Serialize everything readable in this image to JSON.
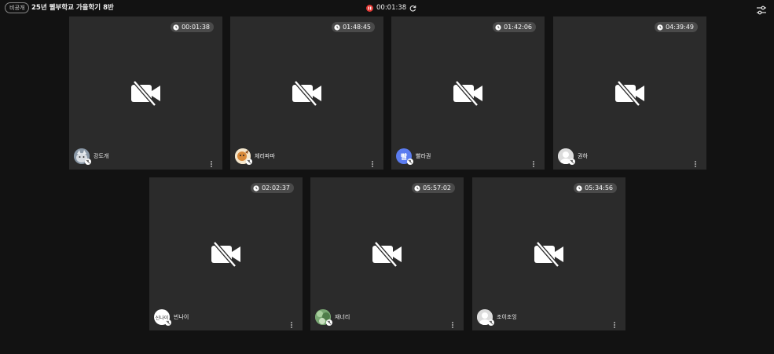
{
  "header": {
    "visibility_badge": "비공개",
    "room_title": "25년 웰부학교 가을학기 8반",
    "recording_time": "00:01:38",
    "recording_color": "#e53935"
  },
  "tiles": [
    {
      "name": "강도개",
      "timer": "00:01:38",
      "avatar": "photo-husky"
    },
    {
      "name": "체리파파",
      "timer": "01:48:45",
      "avatar": "photo-cartoon"
    },
    {
      "name": "빨라권",
      "timer": "01:42:06",
      "avatar": "initial",
      "initial": "빨",
      "avatar_color": "#5b7cf0"
    },
    {
      "name": "권하",
      "timer": "04:39:49",
      "avatar": "default-person"
    },
    {
      "name": "빈나이",
      "timer": "02:02:37",
      "avatar": "signature",
      "signature": "신나이"
    },
    {
      "name": "재너리",
      "timer": "05:57:02",
      "avatar": "photo-green"
    },
    {
      "name": "조이조잉",
      "timer": "05:34:56",
      "avatar": "default-person"
    }
  ],
  "colors": {
    "background": "#121212",
    "tile": "#2b2b2b",
    "timer_pill": "#4a4a4a"
  }
}
